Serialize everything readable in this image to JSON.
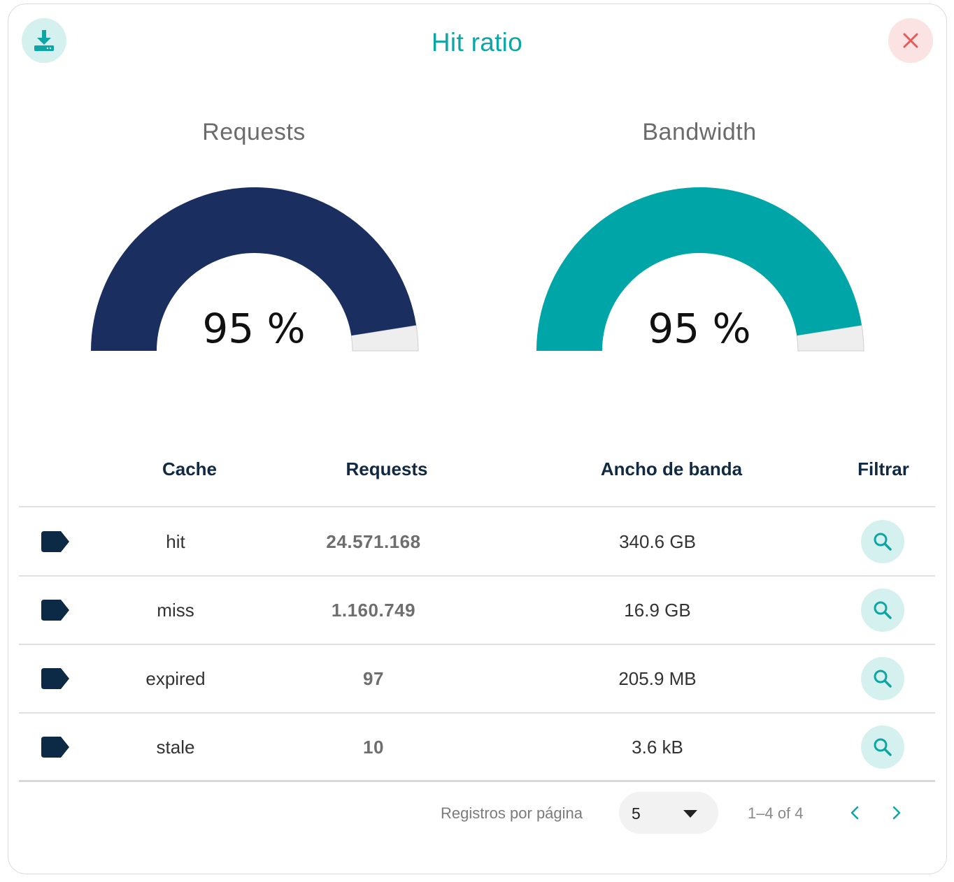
{
  "header": {
    "title": "Hit ratio",
    "download_icon": "download-tray-icon",
    "close_icon": "close-x-icon"
  },
  "gauges": [
    {
      "title": "Requests",
      "value_label": "95 %",
      "fraction": 0.95,
      "color": "#1a2f5f"
    },
    {
      "title": "Bandwidth",
      "value_label": "95 %",
      "fraction": 0.95,
      "color": "#00a5a8"
    }
  ],
  "table": {
    "columns": [
      "Cache",
      "Requests",
      "Ancho de banda",
      "Filtrar"
    ],
    "rows": [
      {
        "cache": "hit",
        "requests": "24.571.168",
        "bandwidth": "340.6 GB"
      },
      {
        "cache": "miss",
        "requests": "1.160.749",
        "bandwidth": "16.9 GB"
      },
      {
        "cache": "expired",
        "requests": "97",
        "bandwidth": "205.9 MB"
      },
      {
        "cache": "stale",
        "requests": "10",
        "bandwidth": "3.6 kB"
      }
    ],
    "tag_icon": "label-tag-icon",
    "filter_icon": "search-icon",
    "tag_color": "#0c2a45"
  },
  "pagination": {
    "rows_per_page_label": "Registros por página",
    "rows_per_page_value": "5",
    "range": "1–4 of 4"
  },
  "colors": {
    "accent": "#0ea5a5",
    "accent_light": "#d4f1f0",
    "close_bg": "#fbe3e3",
    "close_fg": "#e85a5a",
    "gauge_track": "#eeeeee"
  }
}
